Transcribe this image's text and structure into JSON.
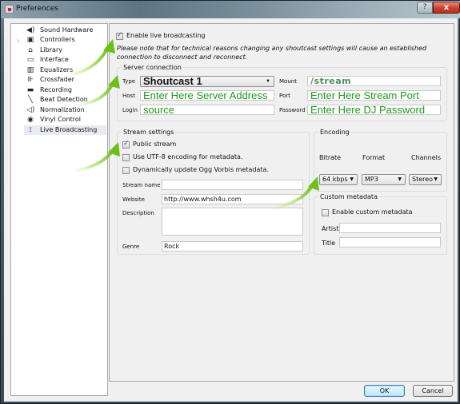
{
  "window": {
    "title": "Preferences",
    "help_label": "?",
    "close_label": "x"
  },
  "nav": {
    "items": [
      {
        "label": "Sound Hardware",
        "icon": "speaker-icon",
        "glyph": "🔈"
      },
      {
        "label": "Controllers",
        "icon": "controller-icon",
        "glyph": "▣",
        "expandable": true
      },
      {
        "label": "Library",
        "icon": "library-icon",
        "glyph": "🏛"
      },
      {
        "label": "Interface",
        "icon": "monitor-icon",
        "glyph": "▭"
      },
      {
        "label": "Equalizers",
        "icon": "equalizer-icon",
        "glyph": "▥"
      },
      {
        "label": "Crossfader",
        "icon": "crossfader-icon",
        "glyph": "⊪"
      },
      {
        "label": "Recording",
        "icon": "recording-icon",
        "glyph": "▬"
      },
      {
        "label": "Beat Detection",
        "icon": "beat-detection-icon",
        "glyph": "✎"
      },
      {
        "label": "Normalization",
        "icon": "normalization-icon",
        "glyph": "◁"
      },
      {
        "label": "Vinyl Control",
        "icon": "vinyl-icon",
        "glyph": "◉"
      },
      {
        "label": "Live Broadcasting",
        "icon": "satellite-dish-icon",
        "glyph": "📡",
        "selected": true
      }
    ],
    "expander_glyph": "▷"
  },
  "broadcast": {
    "enable_label": "Enable live broadcasting",
    "enable_checked": true,
    "note": "Please note that for technical reasons changing any shoutcast settings will cause an established connection to disconnect and reconnect."
  },
  "server": {
    "title": "Server connection",
    "type_label": "Type",
    "type_value": "Shoutcast 1",
    "host_label": "Host",
    "host_value": "Enter Here Server Address",
    "login_label": "Login",
    "login_value": "source",
    "mount_label": "Mount",
    "mount_value": "/stream",
    "port_label": "Port",
    "port_value": "Enter Here Stream Port",
    "password_label": "Password",
    "password_value": "Enter Here DJ Password"
  },
  "stream": {
    "title": "Stream settings",
    "public_label": "Public stream",
    "public_checked": true,
    "utf8_label": "Use UTF-8 encoding for metadata.",
    "utf8_checked": false,
    "ogg_label": "Dynamically update Ogg Vorbis metadata.",
    "ogg_checked": false,
    "name_label": "Stream name",
    "name_value": "",
    "website_label": "Website",
    "website_value": "http://www.whsh4u.com",
    "description_label": "Description",
    "description_value": "",
    "genre_label": "Genre",
    "genre_value": "Rock"
  },
  "encoding": {
    "title": "Encoding",
    "bitrate_label": "Bitrate",
    "bitrate_value": "64 kbps",
    "format_label": "Format",
    "format_value": "MP3",
    "channels_label": "Channels",
    "channels_value": "Stereo"
  },
  "custom_metadata": {
    "title": "Custom metadata",
    "enable_label": "Enable custom metadata",
    "enable_checked": false,
    "artist_label": "Artist",
    "artist_value": "",
    "title_label": "Title",
    "title_value": ""
  },
  "buttons": {
    "ok": "OK",
    "cancel": "Cancel"
  },
  "annotation_color": "#7cc520"
}
